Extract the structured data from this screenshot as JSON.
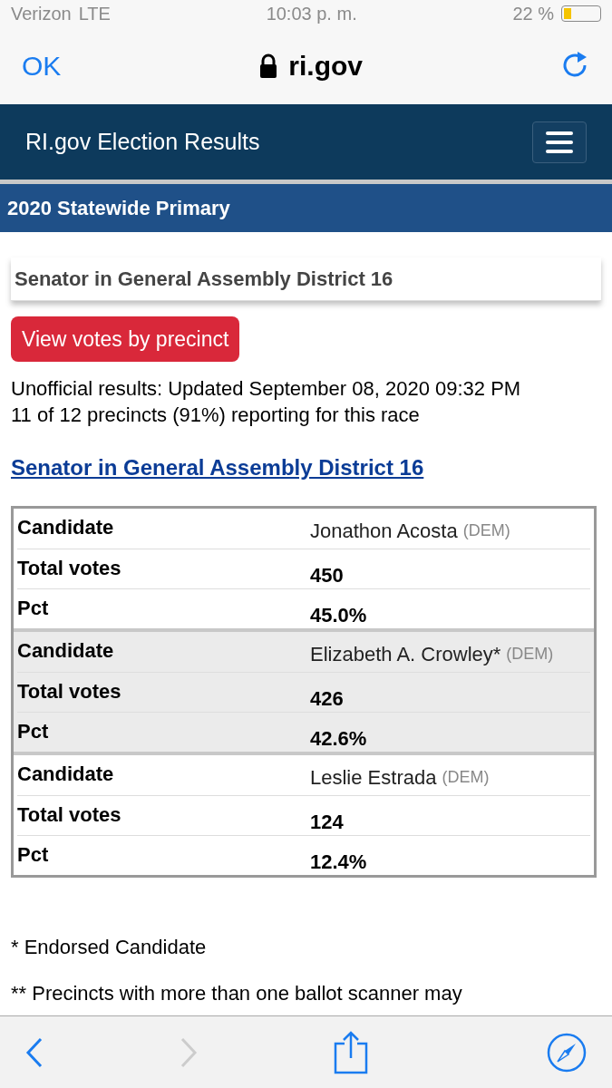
{
  "status_bar": {
    "carrier": "Verizon",
    "network": "LTE",
    "time": "10:03 p. m.",
    "battery": "22 %"
  },
  "browser_bar": {
    "done": "OK",
    "address": "ri.gov"
  },
  "site_header": {
    "title": "RI.gov Election Results"
  },
  "election_band": {
    "title": "2020 Statewide Primary"
  },
  "race_card": {
    "title": "Senator in General Assembly District 16"
  },
  "precinct_button": "View votes by precinct",
  "results_info": [
    "Unofficial results: Updated September 08, 2020 09:32 PM",
    "11 of 12 precincts (91%) reporting for this race"
  ],
  "race_link": "Senator in General Assembly District 16",
  "results_table": [
    {
      "candidate_label": "Candidate",
      "candidate": "Jonathon Acosta",
      "party": "(DEM)",
      "votes_label": "Total votes",
      "votes": "450",
      "pct_label": "Pct",
      "pct": "45.0%"
    },
    {
      "candidate_label": "Candidate",
      "candidate": "Elizabeth A. Crowley*",
      "party": "(DEM)",
      "votes_label": "Total votes",
      "votes": "426",
      "pct_label": "Pct",
      "pct": "42.6%"
    },
    {
      "candidate_label": "Candidate",
      "candidate": "Leslie Estrada",
      "party": "(DEM)",
      "votes_label": "Total votes",
      "votes": "124",
      "pct_label": "Pct",
      "pct": "12.4%"
    }
  ],
  "footnotes": [
    "* Endorsed Candidate",
    "** Precincts with more than one ballot scanner may"
  ]
}
